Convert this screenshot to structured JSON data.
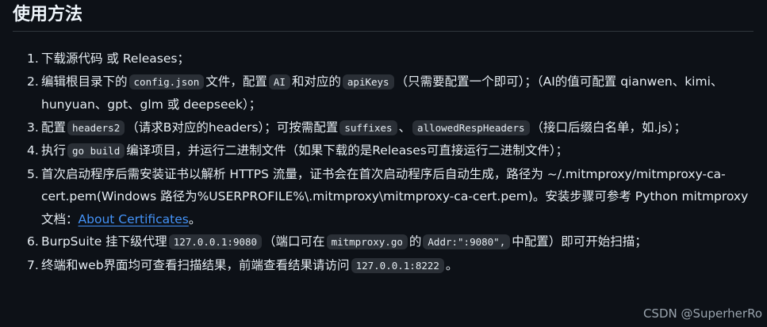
{
  "heading": "使用方法",
  "steps": [
    {
      "num": "1.",
      "t1": "下载源代码 或 Releases；"
    },
    {
      "num": "2.",
      "t1": "编辑根目录下的",
      "c1": "config.json",
      "t2": "文件，配置",
      "c2": "AI",
      "t3": "和对应的",
      "c3": "apiKeys",
      "t4": "（只需要配置一个即可）；（AI的值可配置 qianwen、kimi、hunyuan、gpt、glm 或 deepseek）；"
    },
    {
      "num": "3.",
      "t1": "配置",
      "c1": "headers2",
      "t2": "（请求B对应的headers）；可按需配置",
      "c2": "suffixes",
      "t3": "、",
      "c3": "allowedRespHeaders",
      "t4": "（接口后缀白名单，如.js）；"
    },
    {
      "num": "4.",
      "t1": "执行",
      "c1": "go build",
      "t2": "编译项目，并运行二进制文件（如果下载的是Releases可直接运行二进制文件）；"
    },
    {
      "num": "5.",
      "t1": "首次启动程序后需安装证书以解析 HTTPS 流量，证书会在首次启动程序后自动生成，路径为 ~/.mitmproxy/mitmproxy-ca-cert.pem(Windows 路径为%USERPROFILE%\\.mitmproxy\\mitmproxy-ca-cert.pem)。安装步骤可参考 Python mitmproxy 文档：",
      "link": "About Certificates",
      "t2": "。"
    },
    {
      "num": "6.",
      "t1": "BurpSuite 挂下级代理",
      "c1": "127.0.0.1:9080",
      "t2": "（端口可在",
      "c2": "mitmproxy.go",
      "t3": "的",
      "c3": "Addr:\":9080\",",
      "t4": "中配置）即可开始扫描；"
    },
    {
      "num": "7.",
      "t1": "终端和web界面均可查看扫描结果，前端查看结果请访问",
      "c1": "127.0.0.1:8222",
      "t2": "。"
    }
  ],
  "watermark": "CSDN @SuperherRo"
}
